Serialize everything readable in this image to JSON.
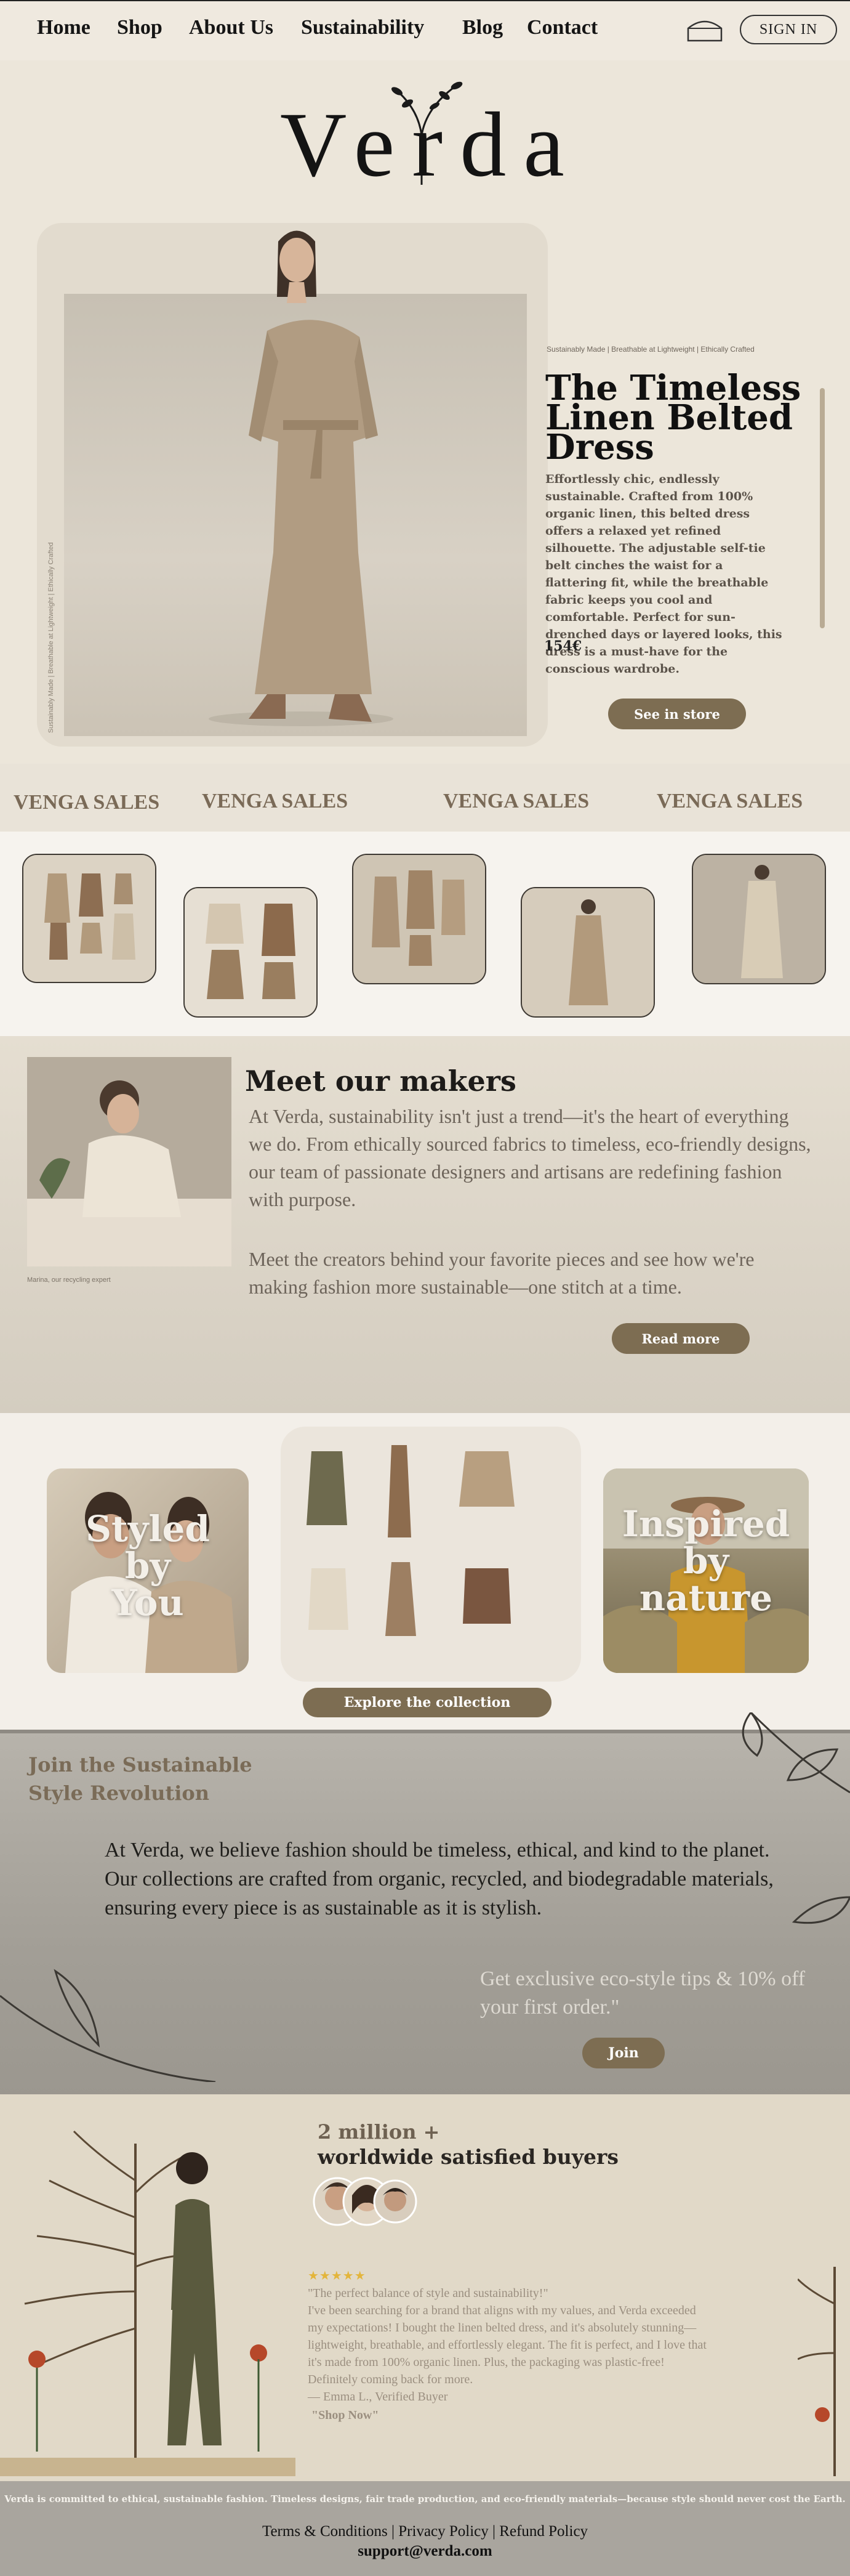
{
  "nav": {
    "items": [
      "Home",
      "Shop",
      "About Us",
      "Sustainability",
      "Blog",
      "Contact"
    ],
    "signin": "SIGN IN",
    "cart_icon": "cart-icon"
  },
  "logo": {
    "text": "Verda"
  },
  "hero": {
    "kicker": "Sustainably Made | Breathable at Lightweight | Ethically Crafted",
    "vertical_text": "Sustainably Made | Breathable at Lightweight | Ethically Crafted",
    "title": "The Timeless Linen Belted Dress",
    "description": "Effortlessly chic, endlessly sustainable. Crafted from 100% organic linen, this belted dress offers a relaxed yet refined silhouette. The adjustable self-tie belt cinches the waist for a flattering fit, while the breathable fabric keeps you cool and comfortable. Perfect for sun-drenched days or layered looks, this dress is a must-have for the conscious wardrobe.",
    "price": "154€",
    "button": "See in store"
  },
  "sales": [
    "VENGA SALES",
    "VENGA SALES",
    "VENGA SALES",
    "VENGA SALES"
  ],
  "makers": {
    "title": "Meet our makers",
    "caption": "Marina, our recycling expert",
    "p1": "At Verda, sustainability isn't just a trend—it's the heart of everything we do. From ethically sourced fabrics to timeless, eco-friendly designs, our team of passionate designers and artisans are redefining fashion with purpose.",
    "p2": "Meet the creators behind your favorite pieces and see how we're making fashion more sustainable—one stitch at a time.",
    "button": "Read more"
  },
  "collection": {
    "left_lines": [
      "Styled",
      "by",
      "You"
    ],
    "right_lines": [
      "Inspired",
      "by",
      "nature"
    ],
    "button": "Explore the collection"
  },
  "newsletter": {
    "title": "Join the Sustainable Style Revolution",
    "p": "At Verda, we believe fashion should be timeless, ethical, and kind to the planet. Our collections are crafted from organic, recycled, and biodegradable materials, ensuring every piece is as sustainable as it is stylish.",
    "offer": "Get exclusive eco-style tips & 10% off your first order.\"",
    "button": "Join"
  },
  "testimonial": {
    "count": "2 million +",
    "subtitle": "worldwide satisfied buyers",
    "stars": "★★★★★",
    "lines": [
      "\"The perfect balance of style and sustainability!\"",
      "I've been searching for a brand that aligns with my values, and Verda exceeded",
      "my expectations! I bought the linen belted dress, and it's absolutely stunning—",
      "lightweight, breathable, and effortlessly elegant. The fit is perfect, and I love that",
      "it's made from 100% organic linen. Plus, the packaging was plastic-free!",
      "Definitely coming back for more.",
      "— Emma L., Verified Buyer"
    ],
    "shop_now": "\"Shop Now\""
  },
  "footer": {
    "mission": "Verda is committed to ethical, sustainable fashion. Timeless designs, fair trade production, and eco-friendly materials—because style should never cost the Earth.",
    "links": [
      "Terms & Conditions",
      "Privacy Policy",
      "Refund Policy"
    ],
    "separator": "|",
    "email": "support@verda.com"
  },
  "colors": {
    "accent": "#7d6d52",
    "background": "#ece6da",
    "footer": "#a9a59e"
  }
}
